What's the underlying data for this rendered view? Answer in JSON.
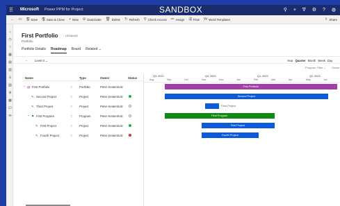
{
  "topbar": {
    "brand": "Microsoft",
    "app_name": "Power PPM for Project",
    "environment_banner": "SANDBOX",
    "icons": [
      "search-icon",
      "plus-icon",
      "filter-icon",
      "gear-icon",
      "help-icon",
      "avatar"
    ]
  },
  "commandbar": {
    "items": [
      {
        "icon": "back-arrow-icon",
        "glyph": "←",
        "label": ""
      },
      {
        "icon": "page-icon",
        "glyph": "▭",
        "label": ""
      },
      {
        "icon": "save-icon",
        "glyph": "🖫",
        "label": "Save"
      },
      {
        "icon": "save-close-icon",
        "glyph": "🖫",
        "label": "Save & Close"
      },
      {
        "icon": "plus-icon",
        "glyph": "+",
        "label": "New"
      },
      {
        "icon": "deactivate-icon",
        "glyph": "⊘",
        "label": "Deactivate"
      },
      {
        "icon": "delete-icon",
        "glyph": "🗑",
        "label": "Delete"
      },
      {
        "icon": "refresh-icon",
        "glyph": "↻",
        "label": "Refresh"
      },
      {
        "icon": "check-access-icon",
        "glyph": "⚲",
        "label": "Check Access"
      },
      {
        "icon": "assign-icon",
        "glyph": "⚯",
        "label": "Assign"
      },
      {
        "icon": "flow-icon",
        "glyph": "⇶",
        "label": "Flow"
      },
      {
        "icon": "word-icon",
        "glyph": "W",
        "label": "Word Templates"
      },
      {
        "icon": "share-icon",
        "glyph": "⇪",
        "label": "Share"
      }
    ]
  },
  "leftnav": {
    "icons": [
      "home-icon",
      "recent-icon",
      "pinned-icon",
      "projects-icon",
      "portfolio-icon",
      "programs-icon",
      "resources-icon",
      "reports-icon",
      "settings-icon",
      "analytics-icon",
      "tasks-icon",
      "more-icon"
    ]
  },
  "record": {
    "title": "First Portfolio",
    "saved_state": "- Unsaved",
    "entity": "Portfolio"
  },
  "tabs": [
    {
      "label": "Portfolio Details",
      "active": false
    },
    {
      "label": "Roadmap",
      "active": true
    },
    {
      "label": "Board",
      "active": false
    },
    {
      "label": "Related",
      "active": false
    }
  ],
  "roadmap": {
    "level_select": "Level 0",
    "scales": [
      {
        "label": "Year",
        "active": false
      },
      {
        "label": "Quarter",
        "active": true
      },
      {
        "label": "Month",
        "active": false
      },
      {
        "label": "Week",
        "active": false
      },
      {
        "label": "Day",
        "active": false
      }
    ],
    "filters": [
      "Program Filter",
      "Owner"
    ],
    "columns": {
      "name": "Name",
      "type": "Type",
      "owner": "Owner",
      "status": "Status"
    },
    "rows": [
      {
        "expander": "⌃",
        "icon": "portfolio-icon",
        "glyph": "▤",
        "name": "First Portfolio",
        "type": "Portfolio",
        "owner": "Peter Kestenholz",
        "status_color": "",
        "indent": 0
      },
      {
        "expander": "",
        "icon": "project-icon",
        "glyph": "✎",
        "name": "Second Project",
        "type": "Project",
        "owner": "Peter Kestenholz",
        "status_color": "#22a93b",
        "indent": 1
      },
      {
        "expander": "",
        "icon": "project-icon",
        "glyph": "✎",
        "name": "Third Project",
        "type": "Project",
        "owner": "Peter Kestenholz",
        "status_color": "#ffffff",
        "indent": 1
      },
      {
        "expander": "⌃",
        "icon": "program-icon",
        "glyph": "⚑",
        "name": "First Program",
        "type": "Program",
        "owner": "Peter Kestenholz",
        "status_color": "#ffffff",
        "indent": 1
      },
      {
        "expander": "",
        "icon": "project-icon",
        "glyph": "✎",
        "name": "First Project",
        "type": "Project",
        "owner": "Peter Kestenholz",
        "status_color": "#22a93b",
        "indent": 2
      },
      {
        "expander": "",
        "icon": "project-icon",
        "glyph": "✎",
        "name": "Fourth Project",
        "type": "Project",
        "owner": "Peter Kestenholz",
        "status_color": "#d13438",
        "indent": 2
      }
    ],
    "timeline": {
      "quarters": [
        "Q3, 2022",
        "Q4, 2022",
        "Q1, 2023",
        "Q2, 2023",
        "Q3, 2023"
      ],
      "months": [
        "Aug",
        "Sep",
        "Oct",
        "Nov",
        "Dec",
        "Jan",
        "Feb",
        "Mar",
        "Apr",
        "May",
        "Jun",
        "Jul"
      ]
    },
    "bars": [
      {
        "label": "First Portfolio",
        "color": "#a13fa8",
        "start_month": 1,
        "end_month": 10.9,
        "label_inside": true
      },
      {
        "label": "Second Project",
        "color": "#0b5ad9",
        "start_month": 1,
        "end_month": 10.4,
        "label_inside": true
      },
      {
        "label": "Third Project",
        "color": "#0b5ad9",
        "start_month": 3.3,
        "end_month": 4.1,
        "label_inside": false
      },
      {
        "label": "First Program",
        "color": "#118a12",
        "start_month": 1,
        "end_month": 7.3,
        "label_inside": true
      },
      {
        "label": "First Project",
        "color": "#0b5ad9",
        "start_month": 3.1,
        "end_month": 7.3,
        "label_inside": true
      },
      {
        "label": "Fourth Project",
        "color": "#0b5ad9",
        "start_month": 3.1,
        "end_month": 6.4,
        "label_inside": true
      }
    ]
  }
}
